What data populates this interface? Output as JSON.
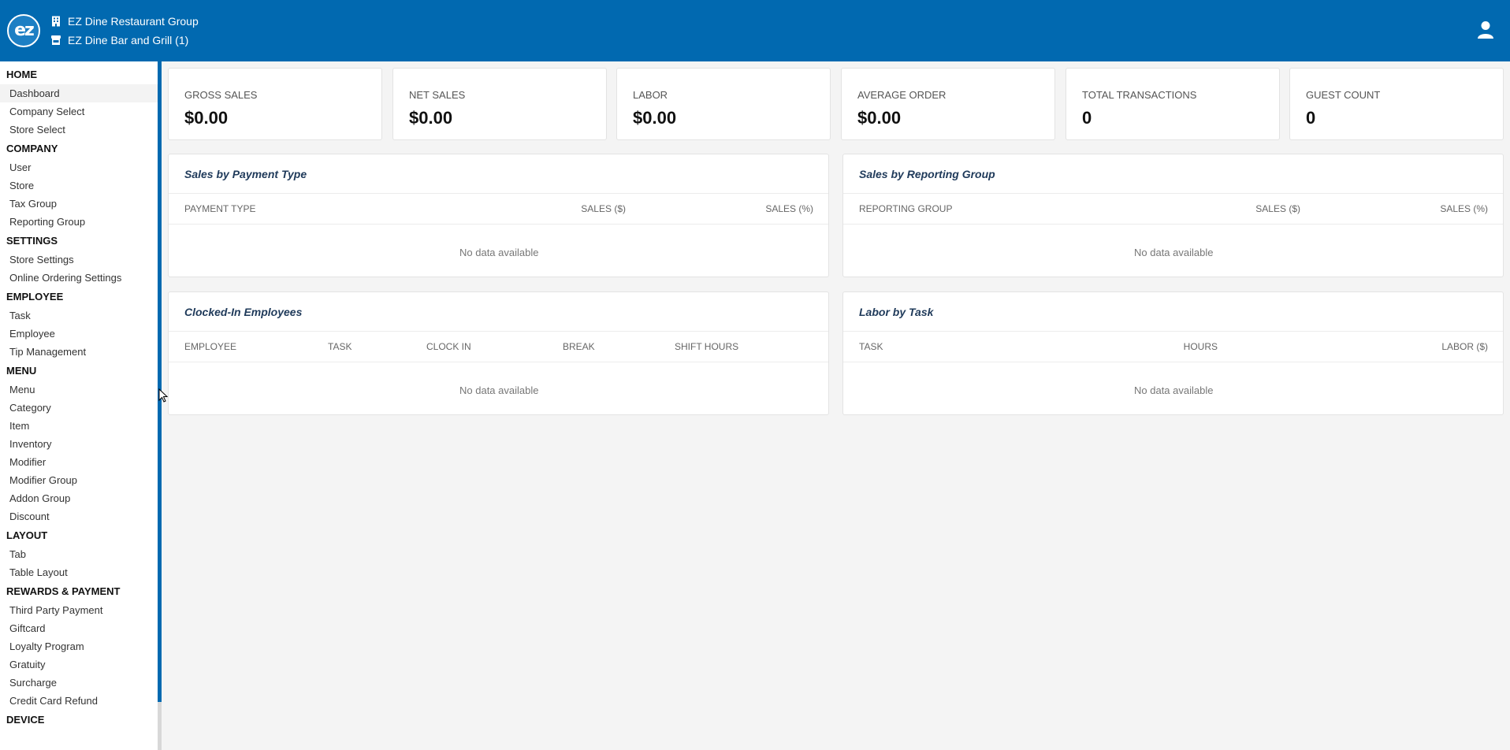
{
  "header": {
    "logo_text": "ez",
    "company_name": "EZ Dine Restaurant Group",
    "store_name": "EZ Dine Bar and Grill (1)",
    "company_icon": "building-icon",
    "store_icon": "store-icon",
    "user_icon": "user-icon",
    "brand_color": "#0169b0"
  },
  "sidebar": {
    "home_label": "HOME",
    "home_items": [
      "Dashboard",
      "Company Select",
      "Store Select"
    ],
    "company_label": "COMPANY",
    "company_items": [
      "User",
      "Store",
      "Tax Group",
      "Reporting Group"
    ],
    "settings_label": "SETTINGS",
    "settings_items": [
      "Store Settings",
      "Online Ordering Settings"
    ],
    "employee_label": "EMPLOYEE",
    "employee_items": [
      "Task",
      "Employee",
      "Tip Management"
    ],
    "menu_label": "MENU",
    "menu_items": [
      "Menu",
      "Category",
      "Item",
      "Inventory",
      "Modifier",
      "Modifier Group",
      "Addon Group",
      "Discount"
    ],
    "layout_label": "LAYOUT",
    "layout_items": [
      "Tab",
      "Table Layout"
    ],
    "rewards_label": "REWARDS & PAYMENT",
    "rewards_items": [
      "Third Party Payment",
      "Giftcard",
      "Loyalty Program",
      "Gratuity",
      "Surcharge",
      "Credit Card Refund"
    ],
    "device_label": "DEVICE"
  },
  "kpis": [
    {
      "label": "GROSS SALES",
      "value": "$0.00"
    },
    {
      "label": "NET SALES",
      "value": "$0.00"
    },
    {
      "label": "LABOR",
      "value": "$0.00"
    },
    {
      "label": "AVERAGE ORDER",
      "value": "$0.00"
    },
    {
      "label": "TOTAL TRANSACTIONS",
      "value": "0"
    },
    {
      "label": "GUEST COUNT",
      "value": "0"
    }
  ],
  "panels": {
    "payment_type": {
      "title": "Sales by Payment Type",
      "columns": [
        "PAYMENT TYPE",
        "SALES ($)",
        "SALES (%)"
      ],
      "empty": "No data available"
    },
    "reporting_group": {
      "title": "Sales by Reporting Group",
      "columns": [
        "REPORTING GROUP",
        "SALES ($)",
        "SALES (%)"
      ],
      "empty": "No data available"
    },
    "clocked_in": {
      "title": "Clocked-In Employees",
      "columns": [
        "EMPLOYEE",
        "TASK",
        "CLOCK IN",
        "BREAK",
        "SHIFT HOURS"
      ],
      "empty": "No data available"
    },
    "labor_task": {
      "title": "Labor by Task",
      "columns": [
        "TASK",
        "HOURS",
        "LABOR ($)"
      ],
      "empty": "No data available"
    }
  }
}
